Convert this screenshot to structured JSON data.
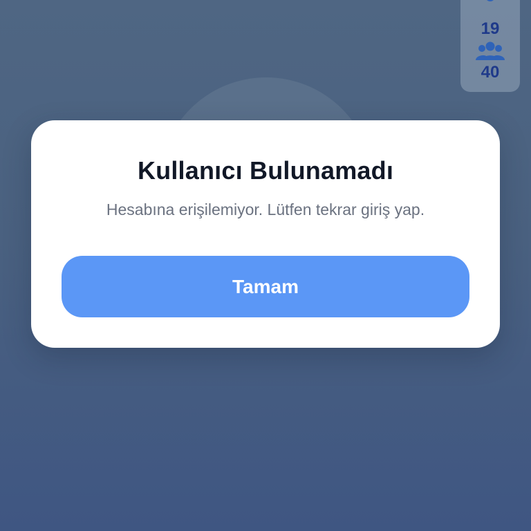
{
  "stats": {
    "top_value": "19",
    "group_value": "40",
    "icons": [
      "person-icon",
      "group-icon"
    ]
  },
  "dialog": {
    "title": "Kullanıcı Bulunamadı",
    "message": "Hesabına erişilemiyor. Lütfen tekrar giriş yap.",
    "button_label": "Tamam"
  },
  "colors": {
    "background": "#4a6180",
    "dialog": "#ffffff",
    "accent_button": "#5b97f6",
    "stat_text": "#1f3a8a",
    "title_text": "#111827",
    "message_text": "#6b7280"
  }
}
